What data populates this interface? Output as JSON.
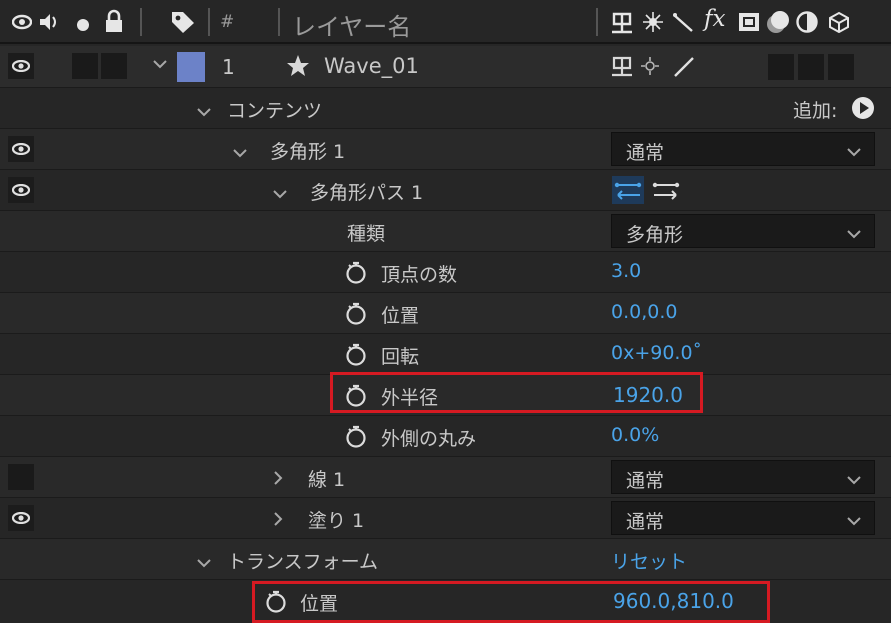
{
  "header": {
    "hash": "#",
    "layer_name_label": "レイヤー名",
    "fx": "fx"
  },
  "layer": {
    "number": "1",
    "name": "Wave_01"
  },
  "contents": {
    "label": "コンテンツ",
    "add_label": "追加:"
  },
  "polygon": {
    "label": "多角形 1",
    "blend_mode": "通常"
  },
  "polygon_path": {
    "label": "多角形パス 1"
  },
  "type": {
    "label": "種類",
    "value": "多角形"
  },
  "points": {
    "label": "頂点の数",
    "value": "3.0"
  },
  "position": {
    "label": "位置",
    "value": "0.0,0.0"
  },
  "rotation": {
    "label": "回転",
    "value": "0x+90.0˚"
  },
  "outer_radius": {
    "label": "外半径",
    "value": "1920.0"
  },
  "outer_roundness": {
    "label": "外側の丸み",
    "value": "0.0%"
  },
  "stroke": {
    "label": "線 1",
    "blend_mode": "通常"
  },
  "fill": {
    "label": "塗り 1",
    "blend_mode": "通常"
  },
  "transform": {
    "label": "トランスフォーム",
    "reset_label": "リセット"
  },
  "transform_position": {
    "label": "位置",
    "value": "960.0,810.0"
  },
  "colors": {
    "label_color": "#6c82c8",
    "value_blue": "#4aa3e8",
    "highlight": "#d51a22"
  }
}
